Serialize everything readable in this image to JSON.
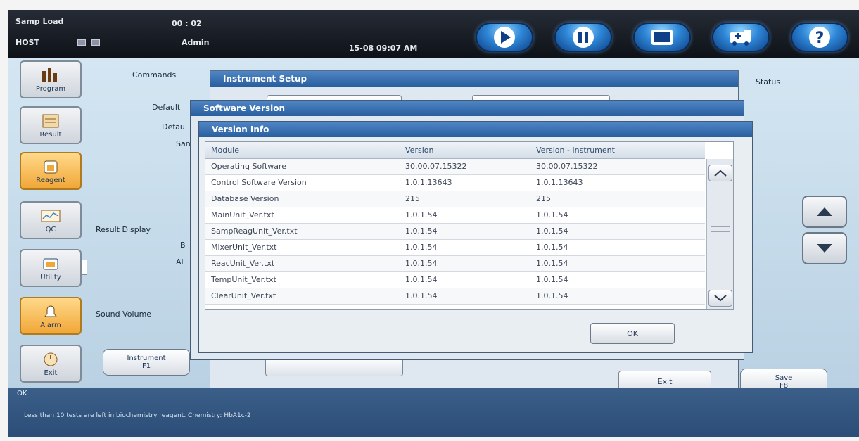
{
  "header": {
    "samp_load": "Samp Load",
    "timer": "00 : 02",
    "host": "HOST",
    "user": "Admin",
    "datetime": "15-08 09:07 AM",
    "toolbar_icons": [
      "play-icon",
      "pause-icon",
      "screen-icon",
      "ambulance-icon",
      "help-icon"
    ]
  },
  "sidebar": {
    "items": [
      {
        "label": "Program",
        "icon": "bar-chart-icon",
        "active": false
      },
      {
        "label": "Result",
        "icon": "result-icon",
        "active": false
      },
      {
        "label": "Reagent",
        "icon": "reagent-icon",
        "active": true
      },
      {
        "label": "QC",
        "icon": "qc-chart-icon",
        "active": false
      },
      {
        "label": "Utility",
        "icon": "utility-icon",
        "active": false
      },
      {
        "label": "Alarm",
        "icon": "alarm-bell-icon",
        "active": true
      },
      {
        "label": "Exit",
        "icon": "exit-icon",
        "active": false
      }
    ]
  },
  "panel": {
    "commands": "Commands",
    "default1": "Default",
    "default2": "Defau",
    "san": "San",
    "result_display": "Result Display",
    "b": "B",
    "ab": "Al",
    "sound_volume": "Sound Volume",
    "instrument_line1": "Instrument",
    "instrument_line2": "F1"
  },
  "right": {
    "status_label": "Status",
    "save_line1": "Save",
    "save_line2": "F8"
  },
  "instrument_setup": {
    "title": "Instrument Setup",
    "exit_label": "Exit"
  },
  "software_version": {
    "title": "Software Version"
  },
  "version_info": {
    "title": "Version Info",
    "columns": [
      "Module",
      "Version",
      "Version - Instrument"
    ],
    "rows": [
      [
        "Operating Software",
        "30.00.07.15322",
        "30.00.07.15322"
      ],
      [
        "Control Software Version",
        "1.0.1.13643",
        "1.0.1.13643"
      ],
      [
        "Database Version",
        "215",
        "215"
      ],
      [
        "MainUnit_Ver.txt",
        "1.0.1.54",
        "1.0.1.54"
      ],
      [
        "SampReagUnit_Ver.txt",
        "1.0.1.54",
        "1.0.1.54"
      ],
      [
        "MixerUnit_Ver.txt",
        "1.0.1.54",
        "1.0.1.54"
      ],
      [
        "ReacUnit_Ver.txt",
        "1.0.1.54",
        "1.0.1.54"
      ],
      [
        "TempUnit_Ver.txt",
        "1.0.1.54",
        "1.0.1.54"
      ],
      [
        "ClearUnit_Ver.txt",
        "1.0.1.54",
        "1.0.1.54"
      ]
    ],
    "ok_label": "OK"
  },
  "statusbar": {
    "state": "OK",
    "message": "Less than 10 tests are left in biochemistry reagent. Chemistry: HbA1c-2"
  },
  "colors": {
    "title_bar": "#2a5f9e",
    "active_sidebar": "#f1a637",
    "toolbar_button": "#2e86d6",
    "statusbar": "#2b4d77"
  }
}
